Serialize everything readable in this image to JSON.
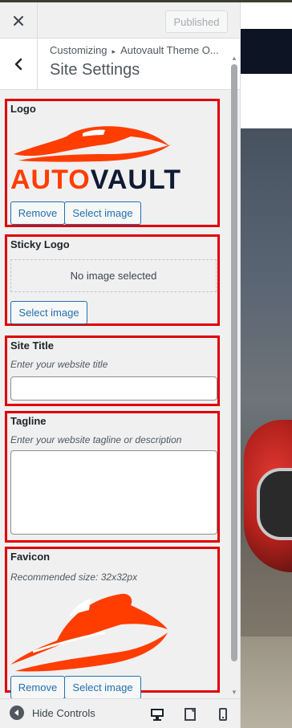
{
  "header": {
    "close_icon": "close-icon",
    "publish_label": "Published"
  },
  "section": {
    "back_icon": "chevron-left-icon",
    "breadcrumb_root": "Customizing",
    "breadcrumb_sep": "▸",
    "breadcrumb_current": "Autovault Theme O...",
    "title": "Site Settings"
  },
  "controls": {
    "logo": {
      "label": "Logo",
      "logo_text_a": "AUTO",
      "logo_text_b": "VAULT",
      "remove_label": "Remove",
      "select_label": "Select image"
    },
    "sticky_logo": {
      "label": "Sticky Logo",
      "placeholder": "No image selected",
      "select_label": "Select image"
    },
    "site_title": {
      "label": "Site Title",
      "description": "Enter your website title",
      "value": ""
    },
    "tagline": {
      "label": "Tagline",
      "description": "Enter your website tagline or description",
      "value": ""
    },
    "favicon": {
      "label": "Favicon",
      "description": "Recommended size: 32x32px",
      "remove_label": "Remove",
      "select_label": "Select image"
    }
  },
  "footer": {
    "hide_label": "Hide Controls",
    "devices": [
      "desktop-icon",
      "tablet-icon",
      "mobile-icon"
    ]
  },
  "colors": {
    "accent": "#2271b1",
    "highlight_border": "#e00000",
    "logo_orange": "#ff3d00",
    "logo_dark": "#0f1b33"
  }
}
